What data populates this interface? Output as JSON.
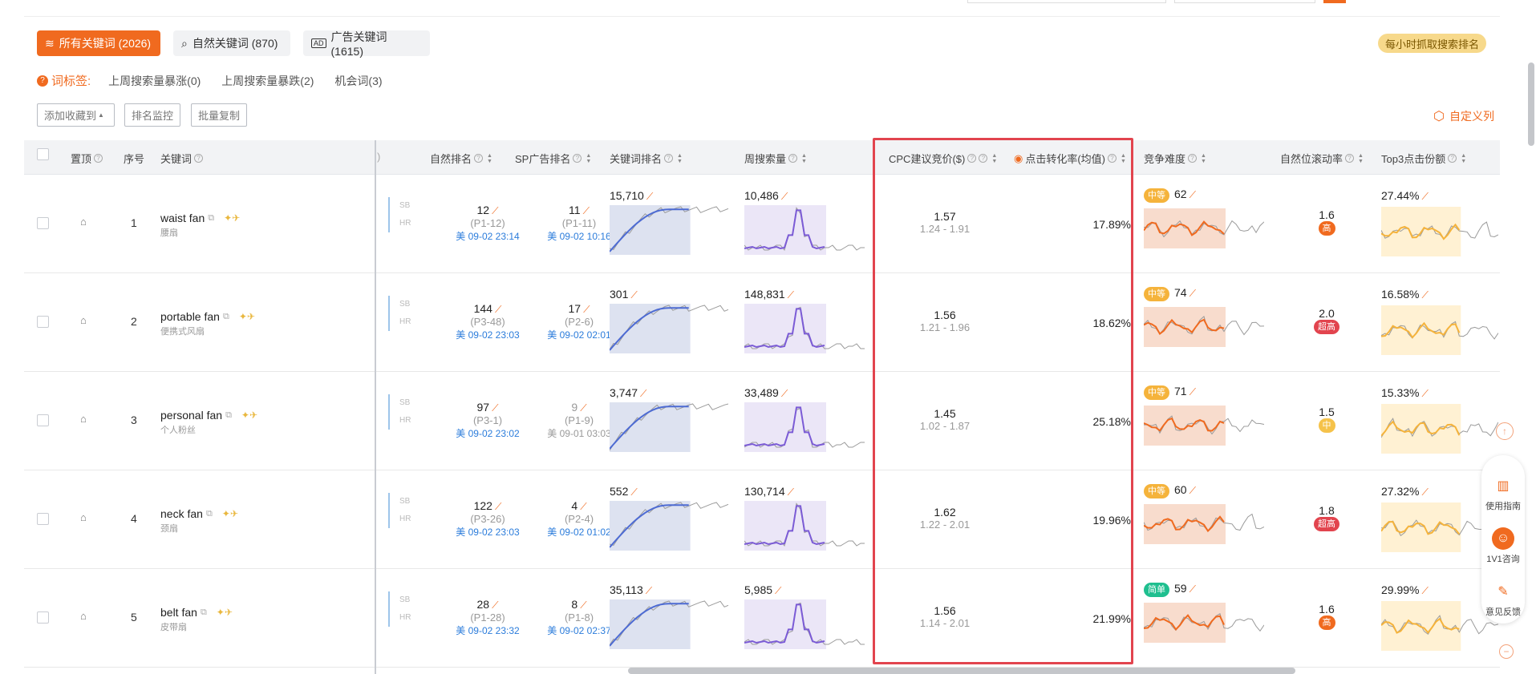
{
  "filters": {
    "tab_all": "所有关键词 (2026)",
    "tab_natural": "自然关键词 (870)",
    "tab_ad": "广告关键词 (1615)",
    "hourly": "每小时抓取搜索排名"
  },
  "tags": {
    "label": "词标签:",
    "items": [
      "上周搜索量暴涨(0)",
      "上周搜索量暴跌(2)",
      "机会词(3)"
    ]
  },
  "toolbar": {
    "add_fav": "添加收藏到",
    "rank_monitor": "排名监控",
    "batch_copy": "批量复制",
    "custom_columns": "自定义列"
  },
  "columns": {
    "pin": "置顶",
    "index": "序号",
    "keyword": "关键词",
    "natural_rank": "自然排名",
    "sp_rank": "SP广告排名",
    "keyword_rank": "关键词排名",
    "weekly_volume": "周搜索量",
    "cpc": "CPC建议竞价($)",
    "ctr": "点击转化率(均值)",
    "competition": "竞争难度",
    "natural_scroll": "自然位滚动率",
    "top3": "Top3点击份额"
  },
  "rows": [
    {
      "idx": "1",
      "kw": "waist fan",
      "kw_cn": "腰扇",
      "nat": "12",
      "nat_p": "(P1-12)",
      "nat_t": "美 09-02 23:14",
      "sp": "11",
      "sp_p": "(P1-11)",
      "sp_t": "美 09-02 10:16",
      "kwr": "15,710",
      "vol": "10,486",
      "cpc": "1.57",
      "cpc_r": "1.24 - 1.91",
      "ctr": "17.89%",
      "comp_tag": "中等",
      "comp": "62",
      "scroll": "1.6",
      "scroll_tag": "高",
      "top3": "27.44%"
    },
    {
      "idx": "2",
      "kw": "portable fan",
      "kw_cn": "便携式风扇",
      "nat": "144",
      "nat_p": "(P3-48)",
      "nat_t": "美 09-02 23:03",
      "sp": "17",
      "sp_p": "(P2-6)",
      "sp_t": "美 09-02 02:01",
      "kwr": "301",
      "vol": "148,831",
      "cpc": "1.56",
      "cpc_r": "1.21 - 1.96",
      "ctr": "18.62%",
      "comp_tag": "中等",
      "comp": "74",
      "scroll": "2.0",
      "scroll_tag": "超高",
      "top3": "16.58%"
    },
    {
      "idx": "3",
      "kw": "personal fan",
      "kw_cn": "个人粉丝",
      "nat": "97",
      "nat_p": "(P3-1)",
      "nat_t": "美 09-02 23:02",
      "sp": "9",
      "sp_p": "(P1-9)",
      "sp_t": "美 09-01 03:03",
      "kwr": "3,747",
      "vol": "33,489",
      "cpc": "1.45",
      "cpc_r": "1.02 - 1.87",
      "ctr": "25.18%",
      "comp_tag": "中等",
      "comp": "71",
      "scroll": "1.5",
      "scroll_tag": "中",
      "top3": "15.33%"
    },
    {
      "idx": "4",
      "kw": "neck fan",
      "kw_cn": "颈扇",
      "nat": "122",
      "nat_p": "(P3-26)",
      "nat_t": "美 09-02 23:03",
      "sp": "4",
      "sp_p": "(P2-4)",
      "sp_t": "美 09-02 01:02",
      "kwr": "552",
      "vol": "130,714",
      "cpc": "1.62",
      "cpc_r": "1.22 - 2.01",
      "ctr": "19.96%",
      "comp_tag": "中等",
      "comp": "60",
      "scroll": "1.8",
      "scroll_tag": "超高",
      "top3": "27.32%"
    },
    {
      "idx": "5",
      "kw": "belt fan",
      "kw_cn": "皮带扇",
      "nat": "28",
      "nat_p": "(P1-28)",
      "nat_t": "美 09-02 23:32",
      "sp": "8",
      "sp_p": "(P1-8)",
      "sp_t": "美 09-02 02:37",
      "kwr": "35,113",
      "vol": "5,985",
      "cpc": "1.56",
      "cpc_r": "1.14 - 2.01",
      "ctr": "21.99%",
      "comp_tag": "简单",
      "comp": "59",
      "scroll": "1.6",
      "scroll_tag": "高",
      "top3": "29.99%"
    }
  ],
  "row_labels": {
    "sb": "SB",
    "hr": "HR"
  },
  "side": {
    "guide": "使用指南",
    "consult": "1V1咨询",
    "feedback": "意见反馈"
  },
  "colors": {
    "accent": "#f06a1f",
    "highlight": "#e2444e",
    "link": "#2b7cdb"
  }
}
